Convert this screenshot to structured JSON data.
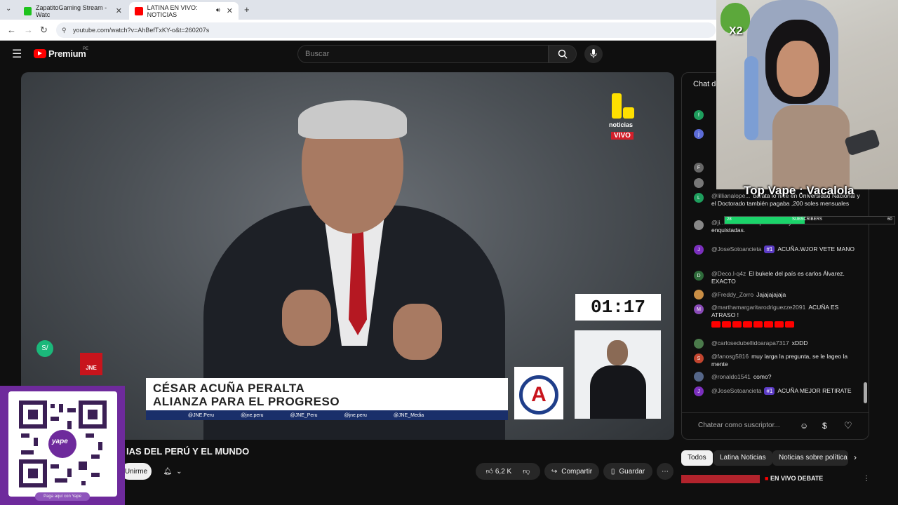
{
  "browser": {
    "tabs": [
      {
        "title": "ZapatitoGaming Stream - Watc",
        "active": false
      },
      {
        "title": "LATINA EN VIVO: NOTICIAS",
        "active": true
      }
    ],
    "url": "youtube.com/watch?v=AhBefTxKY-o&t=260207s"
  },
  "youtube": {
    "logo_text": "Premium",
    "region": "PE",
    "search_placeholder": "Buscar"
  },
  "video": {
    "channel_logo": "noticias",
    "live_label": "VIVO",
    "timer": "01:17",
    "lower_third_line1": "CÉSAR ACUÑA PERALTA",
    "lower_third_line2": "ALIANZA PARA EL PROGRESO",
    "socials": [
      "@JNE.Peru",
      "@jne.peru",
      "@JNE_Peru",
      "@jne.peru",
      "@JNE_Media"
    ],
    "left_logo": "JNE",
    "party_letter": "A"
  },
  "below_video": {
    "title": "IAS DEL PERÚ Y EL MUNDO",
    "join_label": "Unirme",
    "likes": "6,2 K",
    "share_label": "Compartir",
    "save_label": "Guardar"
  },
  "chat": {
    "header": "Chat de",
    "messages": [
      {
        "author": "@lillianalope...",
        "text": "barata lo hice en Universidad Nacional y el Doctorado también pagaba ,200 soles mensuales",
        "avatar": "L",
        "color": "#1e9e5d"
      },
      {
        "author": "@ji...",
        "text": "merece ser presidente y botar a todas las enquistadas.",
        "avatar": "",
        "color": "#888888"
      },
      {
        "author": "@JoseSotoancieta",
        "badge": "#1",
        "text": "ACUÑA.WJOR VETE MANO",
        "avatar": "J",
        "color": "#7b2fbe"
      },
      {
        "author": "@Deco.l-q4z",
        "text": "El bukele del país es carlos Álvarez. EXACTO",
        "avatar": "D",
        "color": "#2e6b3a"
      },
      {
        "author": "@Freddy_Zorro",
        "text": "Jajajajajaja",
        "avatar": "",
        "color": "#c98e45"
      },
      {
        "author": "@marthamargaritarodriguezze2091",
        "text": "ACUÑA ES ATRASO !",
        "avatar": "M",
        "color": "#8a4bb8"
      },
      {
        "author": "@carlosedubellidoarapa7317",
        "text": "xDDD",
        "avatar": "",
        "color": "#4b7a4b"
      },
      {
        "author": "@fanosg5816",
        "text": "muy larga la pregunta, se le lageo la mente",
        "avatar": "S",
        "color": "#c2452f"
      },
      {
        "author": "@ronaldo1541",
        "text": "como?",
        "avatar": "",
        "color": "#556688"
      },
      {
        "author": "@JoseSotoancieta",
        "badge": "#1",
        "text": "ACUÑA MEJOR RETIRATE",
        "avatar": "J",
        "color": "#7b2fbe"
      }
    ],
    "input_placeholder": "Chatear como suscriptor..."
  },
  "chips": {
    "items": [
      "Todos",
      "Latina Noticias",
      "Noticias sobre política"
    ],
    "next_video_title": "EN VIVO DEBATE"
  },
  "overlay": {
    "top_vape_label": "Top Vape : Vacalola",
    "sub_left": "28",
    "sub_label": "SUBSCRIBERS",
    "sub_right": "60",
    "sub_progress": 0.47,
    "multiplier": "X2",
    "qr_brand": "yape",
    "qr_caption": "Paga aquí con Yape",
    "yape_currency": "S/"
  }
}
